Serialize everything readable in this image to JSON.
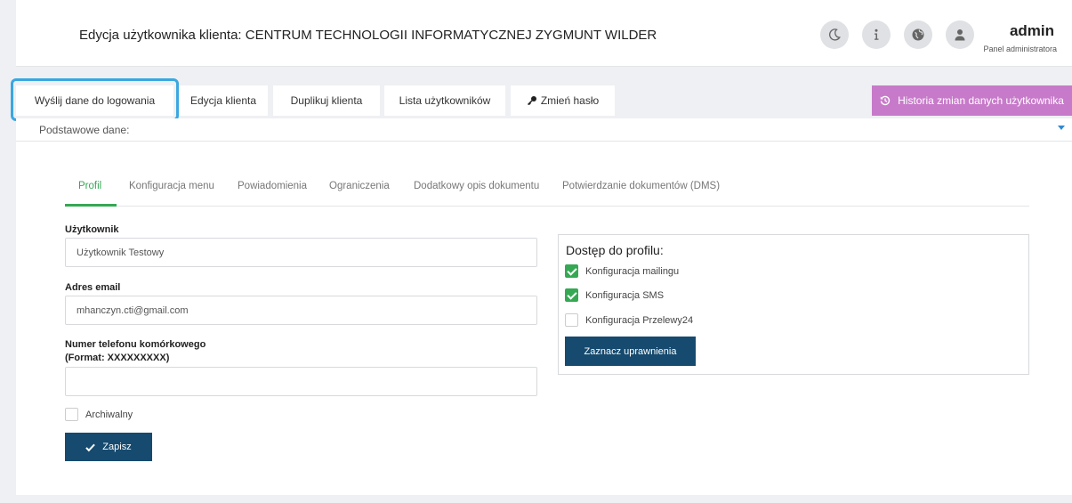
{
  "header": {
    "title": "Edycja użytkownika klienta: CENTRUM TECHNOLOGII INFORMATYCZNEJ ZYGMUNT WILDER",
    "icons": [
      "moon-icon",
      "info-icon",
      "globe-icon",
      "user-icon"
    ],
    "user_name": "admin",
    "user_role": "Panel administratora"
  },
  "tabs": {
    "send_login": "Wyślij dane do logowania",
    "edit_client": "Edycja klienta",
    "duplicate_client": "Duplikuj klienta",
    "users_list": "Lista użytkowników",
    "change_password": "Zmień hasło",
    "history": "Historia zmian danych użytkownika"
  },
  "section": {
    "title": "Podstawowe dane:"
  },
  "subtabs": {
    "profile": "Profil",
    "menu_config": "Konfiguracja menu",
    "notifications": "Powiadomienia",
    "restrictions": "Ograniczenia",
    "doc_description": "Dodatkowy opis dokumentu",
    "doc_confirm": "Potwierdzanie dokumentów (DMS)"
  },
  "form": {
    "user_label": "Użytkownik",
    "user_value": "Użytkownik Testowy",
    "email_label": "Adres email",
    "email_value": "mhanczyn.cti@gmail.com",
    "phone_label_line1": "Numer telefonu komórkowego",
    "phone_label_line2": "(Format: XXXXXXXXX)",
    "phone_value": "",
    "archived_label": "Archiwalny",
    "archived_checked": false,
    "save_label": "Zapisz"
  },
  "access": {
    "title": "Dostęp do profilu:",
    "items": [
      {
        "label": "Konfiguracja mailingu",
        "checked": true
      },
      {
        "label": "Konfiguracja SMS",
        "checked": true
      },
      {
        "label": "Konfiguracja Przelewy24",
        "checked": false
      }
    ],
    "button_label": "Zaznacz uprawnienia"
  },
  "colors": {
    "accent_green": "#35a853",
    "primary_dark": "#164a6e",
    "history_purple": "#c77ac9",
    "highlight_blue": "#3aa7e0"
  }
}
